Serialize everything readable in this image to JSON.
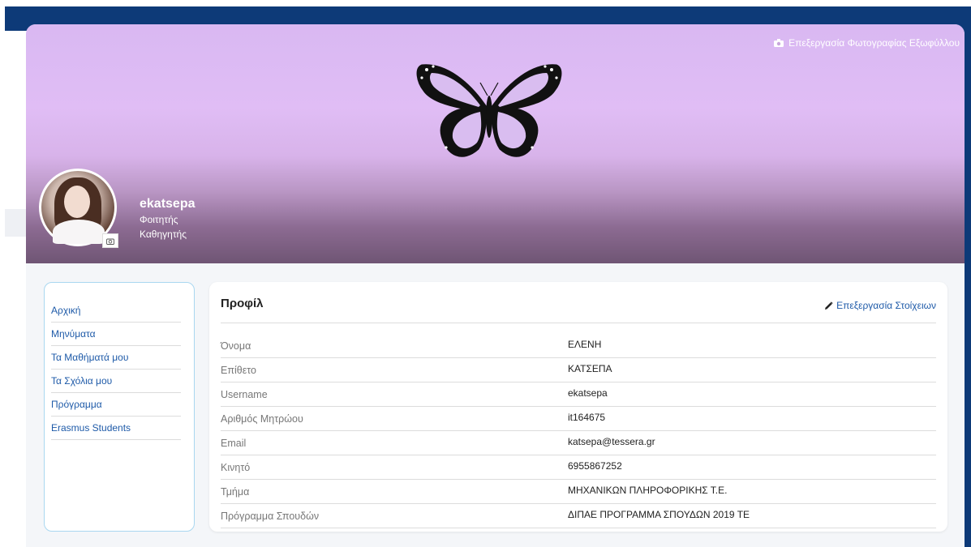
{
  "cover": {
    "edit_label": "Επεξεργασία Φωτογραφίας Εξωφύλλου",
    "edit_icon": "camera-icon",
    "gradient_top": "#d9b8f2",
    "gradient_bottom": "#6f5574"
  },
  "user": {
    "username": "ekatsepa",
    "roles": [
      "Φοιτητής",
      "Καθηγητής"
    ],
    "avatar_badge_icon": "camera-icon"
  },
  "sidebar": {
    "items": [
      {
        "label": "Αρχική"
      },
      {
        "label": "Μηνύματα"
      },
      {
        "label": "Τα Μαθήματά μου"
      },
      {
        "label": "Τα Σχόλια μου"
      },
      {
        "label": "Πρόγραμμα"
      },
      {
        "label": "Erasmus Students"
      }
    ]
  },
  "profile": {
    "title": "Προφίλ",
    "edit_label": "Επεξεργασία Στοίχειων",
    "edit_icon": "pencil-icon",
    "rows": [
      {
        "label": "Όνομα",
        "value": "ΕΛΕΝΗ"
      },
      {
        "label": "Επίθετο",
        "value": "ΚΑΤΣΕΠΑ"
      },
      {
        "label": "Username",
        "value": "ekatsepa"
      },
      {
        "label": "Αριθμός Μητρώου",
        "value": "it164675"
      },
      {
        "label": "Email",
        "value": "katsepa@tessera.gr"
      },
      {
        "label": "Κινητό",
        "value": "6955867252"
      },
      {
        "label": "Τμήμα",
        "value": "ΜΗΧΑΝΙΚΩΝ ΠΛΗΡΟΦΟΡΙΚΗΣ Τ.Ε."
      },
      {
        "label": "Πρόγραμμα Σπουδών",
        "value": "ΔΙΠΑΕ ΠΡΟΓΡΑΜΜΑ ΣΠΟΥΔΩΝ 2019 ΤΕ"
      }
    ]
  },
  "colors": {
    "navy": "#0d3a78",
    "link": "#1e5aa8",
    "sidebar_border": "#a9d7f0"
  }
}
